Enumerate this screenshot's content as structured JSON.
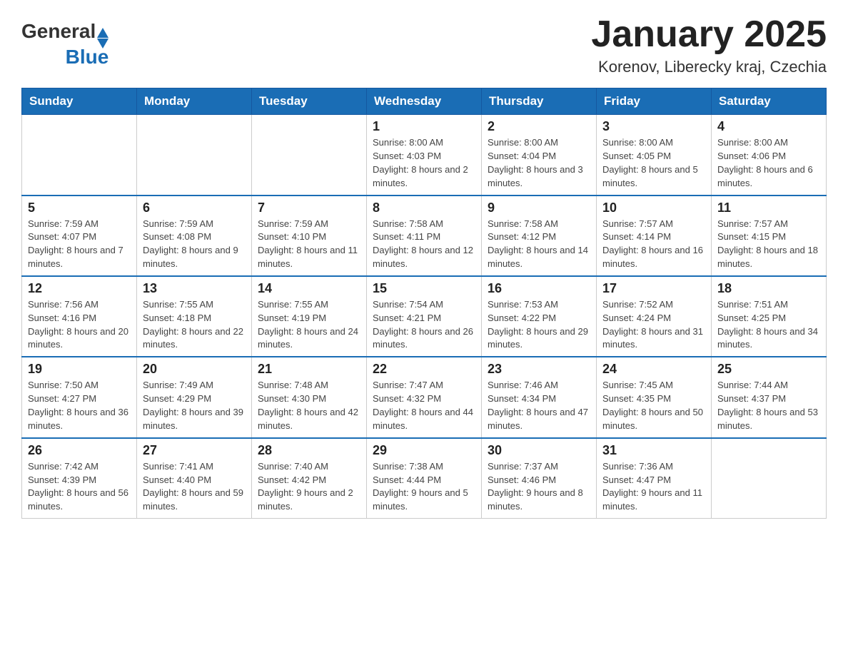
{
  "header": {
    "month_title": "January 2025",
    "location": "Korenov, Liberecky kraj, Czechia"
  },
  "logo": {
    "text_general": "General",
    "text_blue": "Blue"
  },
  "days_of_week": [
    "Sunday",
    "Monday",
    "Tuesday",
    "Wednesday",
    "Thursday",
    "Friday",
    "Saturday"
  ],
  "weeks": [
    [
      {
        "day": "",
        "info": ""
      },
      {
        "day": "",
        "info": ""
      },
      {
        "day": "",
        "info": ""
      },
      {
        "day": "1",
        "info": "Sunrise: 8:00 AM\nSunset: 4:03 PM\nDaylight: 8 hours and 2 minutes."
      },
      {
        "day": "2",
        "info": "Sunrise: 8:00 AM\nSunset: 4:04 PM\nDaylight: 8 hours and 3 minutes."
      },
      {
        "day": "3",
        "info": "Sunrise: 8:00 AM\nSunset: 4:05 PM\nDaylight: 8 hours and 5 minutes."
      },
      {
        "day": "4",
        "info": "Sunrise: 8:00 AM\nSunset: 4:06 PM\nDaylight: 8 hours and 6 minutes."
      }
    ],
    [
      {
        "day": "5",
        "info": "Sunrise: 7:59 AM\nSunset: 4:07 PM\nDaylight: 8 hours and 7 minutes."
      },
      {
        "day": "6",
        "info": "Sunrise: 7:59 AM\nSunset: 4:08 PM\nDaylight: 8 hours and 9 minutes."
      },
      {
        "day": "7",
        "info": "Sunrise: 7:59 AM\nSunset: 4:10 PM\nDaylight: 8 hours and 11 minutes."
      },
      {
        "day": "8",
        "info": "Sunrise: 7:58 AM\nSunset: 4:11 PM\nDaylight: 8 hours and 12 minutes."
      },
      {
        "day": "9",
        "info": "Sunrise: 7:58 AM\nSunset: 4:12 PM\nDaylight: 8 hours and 14 minutes."
      },
      {
        "day": "10",
        "info": "Sunrise: 7:57 AM\nSunset: 4:14 PM\nDaylight: 8 hours and 16 minutes."
      },
      {
        "day": "11",
        "info": "Sunrise: 7:57 AM\nSunset: 4:15 PM\nDaylight: 8 hours and 18 minutes."
      }
    ],
    [
      {
        "day": "12",
        "info": "Sunrise: 7:56 AM\nSunset: 4:16 PM\nDaylight: 8 hours and 20 minutes."
      },
      {
        "day": "13",
        "info": "Sunrise: 7:55 AM\nSunset: 4:18 PM\nDaylight: 8 hours and 22 minutes."
      },
      {
        "day": "14",
        "info": "Sunrise: 7:55 AM\nSunset: 4:19 PM\nDaylight: 8 hours and 24 minutes."
      },
      {
        "day": "15",
        "info": "Sunrise: 7:54 AM\nSunset: 4:21 PM\nDaylight: 8 hours and 26 minutes."
      },
      {
        "day": "16",
        "info": "Sunrise: 7:53 AM\nSunset: 4:22 PM\nDaylight: 8 hours and 29 minutes."
      },
      {
        "day": "17",
        "info": "Sunrise: 7:52 AM\nSunset: 4:24 PM\nDaylight: 8 hours and 31 minutes."
      },
      {
        "day": "18",
        "info": "Sunrise: 7:51 AM\nSunset: 4:25 PM\nDaylight: 8 hours and 34 minutes."
      }
    ],
    [
      {
        "day": "19",
        "info": "Sunrise: 7:50 AM\nSunset: 4:27 PM\nDaylight: 8 hours and 36 minutes."
      },
      {
        "day": "20",
        "info": "Sunrise: 7:49 AM\nSunset: 4:29 PM\nDaylight: 8 hours and 39 minutes."
      },
      {
        "day": "21",
        "info": "Sunrise: 7:48 AM\nSunset: 4:30 PM\nDaylight: 8 hours and 42 minutes."
      },
      {
        "day": "22",
        "info": "Sunrise: 7:47 AM\nSunset: 4:32 PM\nDaylight: 8 hours and 44 minutes."
      },
      {
        "day": "23",
        "info": "Sunrise: 7:46 AM\nSunset: 4:34 PM\nDaylight: 8 hours and 47 minutes."
      },
      {
        "day": "24",
        "info": "Sunrise: 7:45 AM\nSunset: 4:35 PM\nDaylight: 8 hours and 50 minutes."
      },
      {
        "day": "25",
        "info": "Sunrise: 7:44 AM\nSunset: 4:37 PM\nDaylight: 8 hours and 53 minutes."
      }
    ],
    [
      {
        "day": "26",
        "info": "Sunrise: 7:42 AM\nSunset: 4:39 PM\nDaylight: 8 hours and 56 minutes."
      },
      {
        "day": "27",
        "info": "Sunrise: 7:41 AM\nSunset: 4:40 PM\nDaylight: 8 hours and 59 minutes."
      },
      {
        "day": "28",
        "info": "Sunrise: 7:40 AM\nSunset: 4:42 PM\nDaylight: 9 hours and 2 minutes."
      },
      {
        "day": "29",
        "info": "Sunrise: 7:38 AM\nSunset: 4:44 PM\nDaylight: 9 hours and 5 minutes."
      },
      {
        "day": "30",
        "info": "Sunrise: 7:37 AM\nSunset: 4:46 PM\nDaylight: 9 hours and 8 minutes."
      },
      {
        "day": "31",
        "info": "Sunrise: 7:36 AM\nSunset: 4:47 PM\nDaylight: 9 hours and 11 minutes."
      },
      {
        "day": "",
        "info": ""
      }
    ]
  ]
}
